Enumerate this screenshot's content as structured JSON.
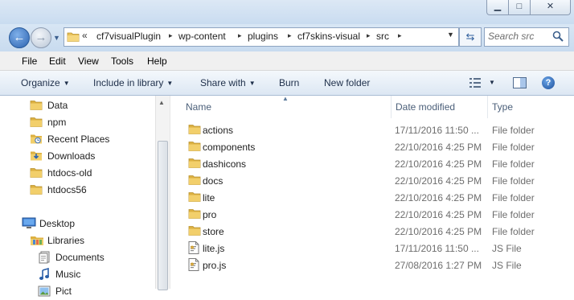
{
  "window": {
    "minimize_glyph": "▁",
    "maximize_glyph": "□",
    "close_glyph": "✕"
  },
  "nav": {
    "back_glyph": "←",
    "forward_glyph": "→",
    "recent_glyph": "▼",
    "address_overflow": "«",
    "breadcrumbs": [
      "cf7visualPlugin",
      "wp-content",
      "plugins",
      "cf7skins-visual",
      "src"
    ],
    "separator_glyph": "▸",
    "dropdown_glyph": "▼",
    "refresh_glyph": "⇆",
    "search_placeholder": "Search src"
  },
  "menu": [
    "File",
    "Edit",
    "View",
    "Tools",
    "Help"
  ],
  "commands": {
    "organize": "Organize",
    "include_in_library": "Include in library",
    "share_with": "Share with",
    "burn": "Burn",
    "new_folder": "New folder",
    "caret": "▼",
    "help": "?"
  },
  "sidebar": {
    "favorites": [
      {
        "label": "Data",
        "icon": "folder-icon"
      },
      {
        "label": "npm",
        "icon": "folder-icon"
      },
      {
        "label": "Recent Places",
        "icon": "recent-places-icon"
      },
      {
        "label": "Downloads",
        "icon": "downloads-icon"
      },
      {
        "label": "htdocs-old",
        "icon": "folder-icon"
      },
      {
        "label": "htdocs56",
        "icon": "folder-icon"
      }
    ],
    "desktop": {
      "label": "Desktop",
      "icon": "desktop-icon"
    },
    "libraries": [
      {
        "label": "Libraries",
        "icon": "libraries-icon"
      },
      {
        "label": "Documents",
        "icon": "documents-icon"
      },
      {
        "label": "Music",
        "icon": "music-icon"
      },
      {
        "label": "Pict",
        "icon": "pictures-icon"
      }
    ]
  },
  "columns": {
    "name": "Name",
    "date": "Date modified",
    "type": "Type",
    "sort_glyph": "▲"
  },
  "files": [
    {
      "name": "actions",
      "date": "17/11/2016 11:50 ...",
      "type": "File folder",
      "icon": "folder-icon"
    },
    {
      "name": "components",
      "date": "22/10/2016 4:25 PM",
      "type": "File folder",
      "icon": "folder-icon"
    },
    {
      "name": "dashicons",
      "date": "22/10/2016 4:25 PM",
      "type": "File folder",
      "icon": "folder-icon"
    },
    {
      "name": "docs",
      "date": "22/10/2016 4:25 PM",
      "type": "File folder",
      "icon": "folder-icon"
    },
    {
      "name": "lite",
      "date": "22/10/2016 4:25 PM",
      "type": "File folder",
      "icon": "folder-icon"
    },
    {
      "name": "pro",
      "date": "22/10/2016 4:25 PM",
      "type": "File folder",
      "icon": "folder-icon"
    },
    {
      "name": "store",
      "date": "22/10/2016 4:25 PM",
      "type": "File folder",
      "icon": "folder-icon"
    },
    {
      "name": "lite.js",
      "date": "17/11/2016 11:50 ...",
      "type": "JS File",
      "icon": "js-file-icon"
    },
    {
      "name": "pro.js",
      "date": "27/08/2016 1:27 PM",
      "type": "JS File",
      "icon": "js-file-icon"
    }
  ]
}
